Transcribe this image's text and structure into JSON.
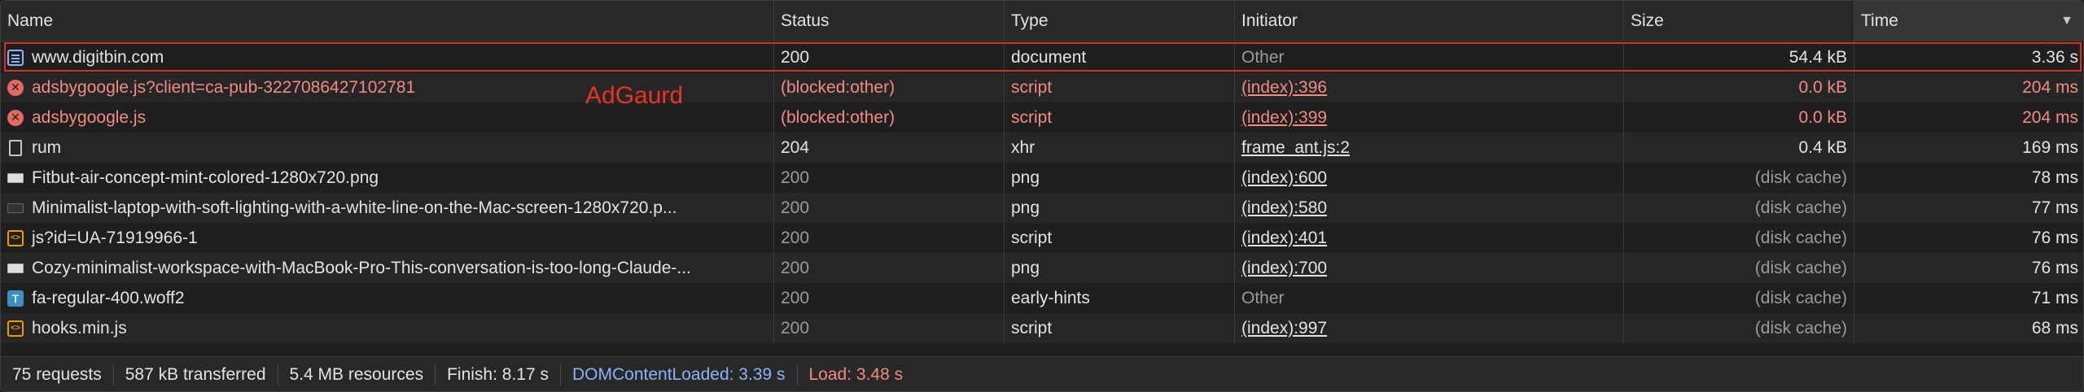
{
  "columns": {
    "name": "Name",
    "status": "Status",
    "type": "Type",
    "initiator": "Initiator",
    "size": "Size",
    "time": "Time",
    "sort_indicator": "▼"
  },
  "rows": [
    {
      "name": "www.digitbin.com",
      "icon": "document-icon",
      "status": "200",
      "type": "document",
      "initiator": "Other",
      "size": "54.4 kB",
      "time": "3.36 s"
    },
    {
      "name": "adsbygoogle.js?client=ca-pub-3227086427102781",
      "icon": "error-icon",
      "status": "(blocked:other)",
      "type": "script",
      "initiator": "(index):396",
      "size": "0.0 kB",
      "time": "204 ms"
    },
    {
      "name": "adsbygoogle.js",
      "icon": "error-icon",
      "status": "(blocked:other)",
      "type": "script",
      "initiator": "(index):399",
      "size": "0.0 kB",
      "time": "204 ms"
    },
    {
      "name": "rum",
      "icon": "file-icon",
      "status": "204",
      "type": "xhr",
      "initiator": "frame_ant.js:2",
      "size": "0.4 kB",
      "time": "169 ms"
    },
    {
      "name": "Fitbut-air-concept-mint-colored-1280x720.png",
      "icon": "image-icon",
      "status": "200",
      "type": "png",
      "initiator": "(index):600",
      "size": "(disk cache)",
      "time": "78 ms"
    },
    {
      "name": "Minimalist-laptop-with-soft-lighting-with-a-white-line-on-the-Mac-screen-1280x720.p...",
      "icon": "image-icon",
      "status": "200",
      "type": "png",
      "initiator": "(index):580",
      "size": "(disk cache)",
      "time": "77 ms"
    },
    {
      "name": "js?id=UA-71919966-1",
      "icon": "script-icon",
      "status": "200",
      "type": "script",
      "initiator": "(index):401",
      "size": "(disk cache)",
      "time": "76 ms"
    },
    {
      "name": "Cozy-minimalist-workspace-with-MacBook-Pro-This-conversation-is-too-long-Claude-...",
      "icon": "image-icon",
      "status": "200",
      "type": "png",
      "initiator": "(index):700",
      "size": "(disk cache)",
      "time": "76 ms"
    },
    {
      "name": "fa-regular-400.woff2",
      "icon": "font-icon",
      "status": "200",
      "type": "early-hints",
      "initiator": "Other",
      "size": "(disk cache)",
      "time": "71 ms"
    },
    {
      "name": "hooks.min.js",
      "icon": "script-icon",
      "status": "200",
      "type": "script",
      "initiator": "(index):997",
      "size": "(disk cache)",
      "time": "68 ms"
    }
  ],
  "annotation": "AdGaurd",
  "footer": {
    "requests": "75 requests",
    "transferred": "587 kB transferred",
    "resources": "5.4 MB resources",
    "finish": "Finish: 8.17 s",
    "dom_content_loaded": "DOMContentLoaded: 3.39 s",
    "load": "Load: 3.48 s"
  },
  "colors": {
    "error": "#f28b82",
    "highlight": "#d93025",
    "dcl": "#8ab4f8"
  }
}
